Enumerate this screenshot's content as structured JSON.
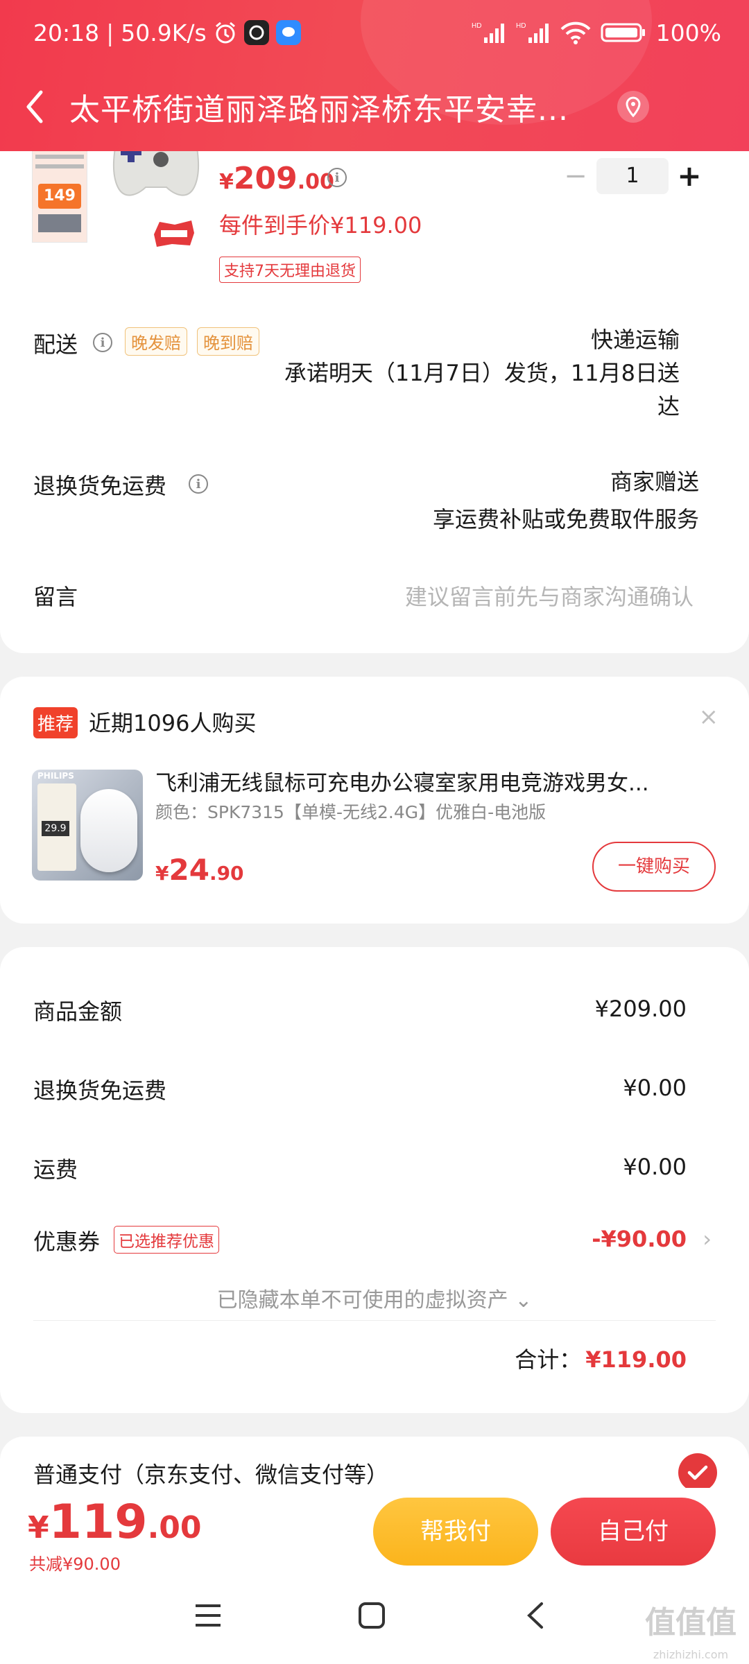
{
  "status_bar": {
    "time": "20:18",
    "speed": "50.9K/s",
    "battery": "100%"
  },
  "header": {
    "address": "太平桥街道丽泽路丽泽桥东平安幸..."
  },
  "product": {
    "thumb_price": "149",
    "price_symbol": "¥",
    "price_int": "209",
    "price_dec": ".00",
    "unit_price_label": "每件到手价¥119.00",
    "return_policy": "支持7天无理由退货",
    "quantity": "1",
    "minus": "−",
    "plus": "+"
  },
  "delivery": {
    "label": "配送",
    "tags": [
      "晚发赔",
      "晚到赔"
    ],
    "method": "快递运输",
    "promise_line1": "承诺明天（11月7日）发货，11月8日送",
    "promise_line2": "达"
  },
  "return_shipping": {
    "label": "退换货免运费",
    "value_line1": "商家赠送",
    "value_line2": "享运费补贴或免费取件服务"
  },
  "message": {
    "label": "留言",
    "placeholder": "建议留言前先与商家沟通确认"
  },
  "recommend": {
    "badge": "推荐",
    "title": "近期1096人购买",
    "close": "×",
    "item_name": "飞利浦无线鼠标可充电办公寝室家用电竞游戏男女...",
    "item_spec": "颜色：SPK7315【单模-无线2.4G】优雅白-电池版",
    "price_symbol": "¥",
    "price_int": "24",
    "price_dec": ".90",
    "buy_label": "一键购买",
    "img_brand": "PHILIPS",
    "img_price": "29.9"
  },
  "summary": {
    "items": [
      {
        "label": "商品金额",
        "value": "¥209.00"
      },
      {
        "label": "退换货免运费",
        "value": "¥0.00"
      },
      {
        "label": "运费",
        "value": "¥0.00"
      }
    ],
    "coupon_label": "优惠券",
    "coupon_tag": "已选推荐优惠",
    "coupon_value": "-¥90.00",
    "hidden_assets": "已隐藏本单不可使用的虚拟资产 ⌄",
    "total_label": "合计：",
    "total_value": "¥119.00"
  },
  "payment": {
    "label": "普通支付（京东支付、微信支付等）"
  },
  "bottom_bar": {
    "price_symbol": "¥",
    "price_int": "119",
    "price_dec": ".00",
    "saved": "共减¥90.00",
    "help_pay": "帮我付",
    "self_pay": "自己付"
  },
  "watermark": {
    "main": "值值值",
    "sub": "zhizhizhi.com"
  },
  "colors": {
    "accent_red": "#e4393c",
    "header_red": "#f2444f",
    "help_yellow": "#fbb41c"
  }
}
